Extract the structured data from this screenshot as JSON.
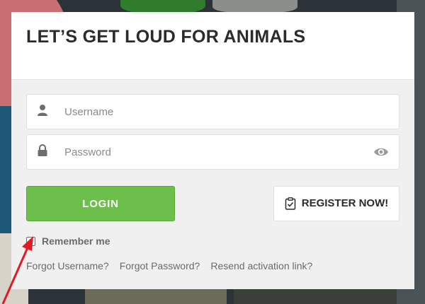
{
  "form": {
    "title": "LET’S GET LOUD FOR ANIMALS",
    "username": {
      "placeholder": "Username",
      "value": "",
      "icon": "user-icon"
    },
    "password": {
      "placeholder": "Password",
      "value": "",
      "icon": "lock-icon",
      "toggle_icon": "eye-icon"
    },
    "login_label": "LOGIN",
    "register_label": "REGISTER NOW!",
    "register_icon": "clipboard-check-icon",
    "remember_label": "Remember me",
    "remember_checked": false,
    "links": {
      "forgot_username": "Forgot Username?",
      "forgot_password": "Forgot Password?",
      "resend_activation": "Resend activation link?"
    }
  },
  "colors": {
    "login_button": "#6cbf4a",
    "panel_background": "#f0f0f0",
    "title_text": "#2b2b2b",
    "annotation_arrow": "#e01b24"
  }
}
